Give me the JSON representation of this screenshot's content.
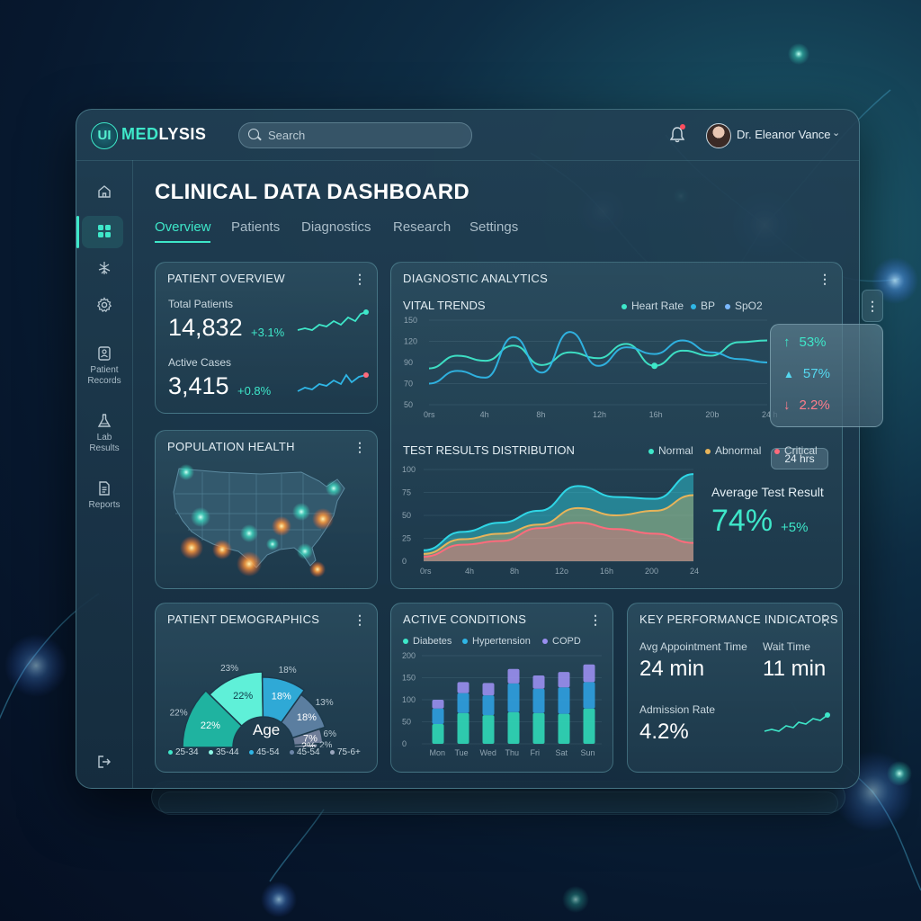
{
  "brand": {
    "badge": "UI",
    "name_accent": "MED",
    "name_rest": "LYSIS"
  },
  "search": {
    "placeholder": "Search"
  },
  "user": {
    "name": "Dr. Eleanor Vance"
  },
  "sidebar": {
    "items": [
      {
        "label": "",
        "icon": "home-icon"
      },
      {
        "label": "",
        "icon": "dashboard-grid-icon"
      },
      {
        "label": "",
        "icon": "brain-icon"
      },
      {
        "label": "",
        "icon": "gear-icon"
      },
      {
        "label": "Patient Records",
        "icon": "patient-records-icon"
      },
      {
        "label": "Lab Results",
        "icon": "flask-icon"
      },
      {
        "label": "Reports",
        "icon": "report-icon"
      },
      {
        "label": "",
        "icon": "logout-icon"
      }
    ]
  },
  "page": {
    "title": "CLINICAL DATA DASHBOARD"
  },
  "tabs": [
    "Overview",
    "Patients",
    "Diagnostics",
    "Research",
    "Settings"
  ],
  "patient_overview": {
    "title": "PATIENT OVERVIEW",
    "total_label": "Total Patients",
    "total_value": "14,832",
    "total_change": "+3.1%",
    "active_label": "Active Cases",
    "active_value": "3,415",
    "active_change": "+0.8%"
  },
  "population_health": {
    "title": "POPULATION HEALTH"
  },
  "diagnostic": {
    "title": "DIAGNOSTIC ANALYTICS",
    "vital_title": "VITAL TRENDS",
    "legend": [
      "Heart Rate",
      "BP",
      "SpO2"
    ],
    "range": "24 hrs",
    "float": {
      "up": "53%",
      "mid": "57%",
      "down": "2.2%"
    },
    "test_title": "TEST RESULTS DISTRIBUTION",
    "test_legend": [
      "Normal",
      "Abnormal",
      "Critical"
    ],
    "avg_label": "Average Test Result",
    "avg_value": "74%",
    "avg_change": "+5%"
  },
  "demographics": {
    "title": "PATIENT DEMOGRAPHICS",
    "center_label": "Age",
    "legend": [
      "25-34",
      "35-44",
      "45-54",
      "45-54",
      "75-6+"
    ]
  },
  "active_conditions": {
    "title": "ACTIVE CONDITIONS",
    "legend": [
      "Diabetes",
      "Hypertension",
      "COPD"
    ]
  },
  "kpi": {
    "title": "KEY PERFORMANCE INDICATORS",
    "appt_label": "Avg Appointment Time",
    "appt_value": "24 min",
    "wait_label": "Wait Time",
    "wait_value": "11 min",
    "admission_label": "Admission Rate",
    "admission_value": "4.2%"
  },
  "colors": {
    "accent": "#3ee7c9",
    "cyan": "#2fb6e6",
    "amber": "#e7b45a",
    "critical": "#ff6b7c"
  },
  "chart_data": [
    {
      "type": "line",
      "title": "VITAL TRENDS",
      "x": [
        "0rs",
        "4h",
        "8h",
        "12h",
        "16h",
        "20b",
        "24 hrs"
      ],
      "y_ticks": [
        50,
        70,
        90,
        120,
        150
      ],
      "ylim": [
        50,
        150
      ],
      "series": [
        {
          "name": "Heart Rate",
          "values": [
            93,
            108,
            102,
            120,
            97,
            112,
            105,
            122,
            96,
            114,
            108,
            124,
            126
          ]
        },
        {
          "name": "BP",
          "values": [
            75,
            90,
            82,
            130,
            88,
            136,
            96,
            118,
            110,
            126,
            112,
            104,
            100
          ]
        }
      ]
    },
    {
      "type": "area",
      "title": "TEST RESULTS DISTRIBUTION",
      "x": [
        "0rs",
        "4h",
        "8h",
        "12o",
        "16h",
        "200",
        "24 hrs"
      ],
      "y_ticks": [
        0,
        25,
        50,
        75,
        100
      ],
      "ylim": [
        0,
        100
      ],
      "series": [
        {
          "name": "Normal",
          "values": [
            12,
            32,
            42,
            55,
            82,
            70,
            68,
            95
          ]
        },
        {
          "name": "Abnormal",
          "values": [
            8,
            24,
            30,
            40,
            58,
            50,
            55,
            72
          ]
        },
        {
          "name": "Critical",
          "values": [
            5,
            18,
            22,
            36,
            42,
            35,
            30,
            20
          ]
        }
      ]
    },
    {
      "type": "pie",
      "title": "PATIENT DEMOGRAPHICS",
      "slices": [
        {
          "label": "22%",
          "value": 22
        },
        {
          "label": "22%",
          "value": 22
        },
        {
          "label": "18%",
          "value": 18
        },
        {
          "label": "18%",
          "value": 18
        },
        {
          "label": "7%",
          "value": 7
        },
        {
          "label": "2%",
          "value": 2
        }
      ],
      "outer_labels": [
        "22%",
        "23%",
        "18%",
        "13%",
        "6%",
        "2%"
      ]
    },
    {
      "type": "bar",
      "title": "ACTIVE CONDITIONS",
      "categories": [
        "Mon",
        "Tue",
        "Wed",
        "Thu",
        "Fri",
        "Sat",
        "Sun"
      ],
      "y_ticks": [
        0,
        50,
        100,
        150,
        200
      ],
      "ylim": [
        0,
        200
      ],
      "series": [
        {
          "name": "Diabetes",
          "values": [
            45,
            70,
            65,
            72,
            70,
            68,
            80
          ]
        },
        {
          "name": "Hypertension",
          "values": [
            35,
            45,
            45,
            65,
            55,
            60,
            60
          ]
        },
        {
          "name": "COPD",
          "values": [
            20,
            25,
            28,
            33,
            30,
            35,
            40
          ]
        }
      ]
    }
  ]
}
